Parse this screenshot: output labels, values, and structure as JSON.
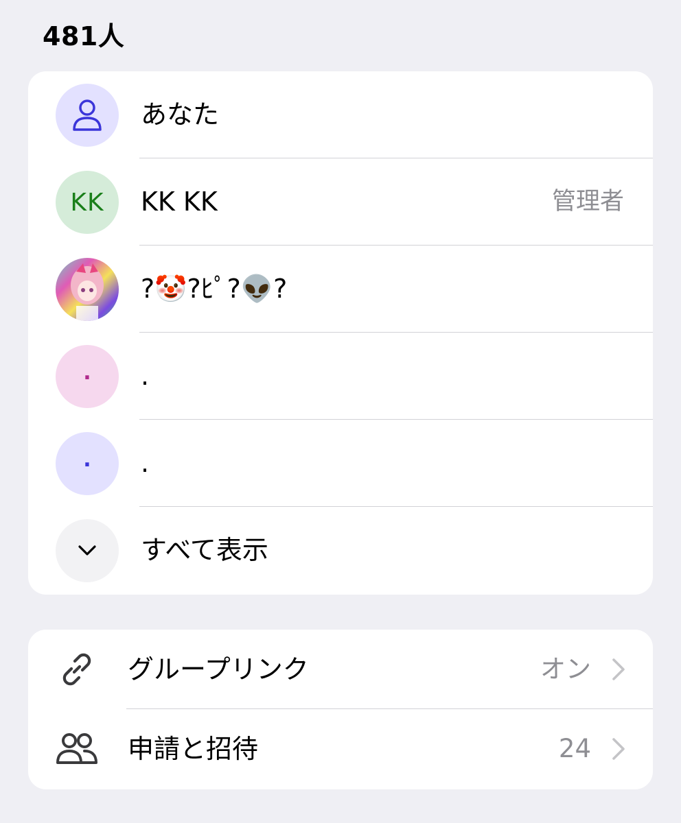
{
  "members": {
    "count_label": "481人",
    "items": [
      {
        "name": "あなた",
        "role": "",
        "avatar": {
          "type": "icon",
          "icon": "person-icon",
          "bg": "#e3e1ff",
          "fg": "#3b35d9"
        }
      },
      {
        "name": "KK KK",
        "role": "管理者",
        "avatar": {
          "type": "initials",
          "text": "KK",
          "bg": "#d5ecd9",
          "fg": "#1a7f1a"
        }
      },
      {
        "name": "?🤡?ﾋﾟ?👽?",
        "role": "",
        "avatar": {
          "type": "image",
          "icon": "profile-photo",
          "bg": "#c97ab8"
        }
      },
      {
        "name": ".",
        "role": "",
        "avatar": {
          "type": "initials",
          "text": ".",
          "bg": "#f6d8ee",
          "fg": "#b02a8c"
        }
      },
      {
        "name": ".",
        "role": "",
        "avatar": {
          "type": "initials",
          "text": ".",
          "bg": "#e3e1ff",
          "fg": "#3b35d9"
        }
      }
    ],
    "show_all_label": "すべて表示",
    "show_all_icon": "chevron-down-icon"
  },
  "settings": {
    "group_link": {
      "label": "グループリンク",
      "value": "オン",
      "icon": "link-icon"
    },
    "requests": {
      "label": "申請と招待",
      "value": "24",
      "icon": "people-icon"
    }
  }
}
